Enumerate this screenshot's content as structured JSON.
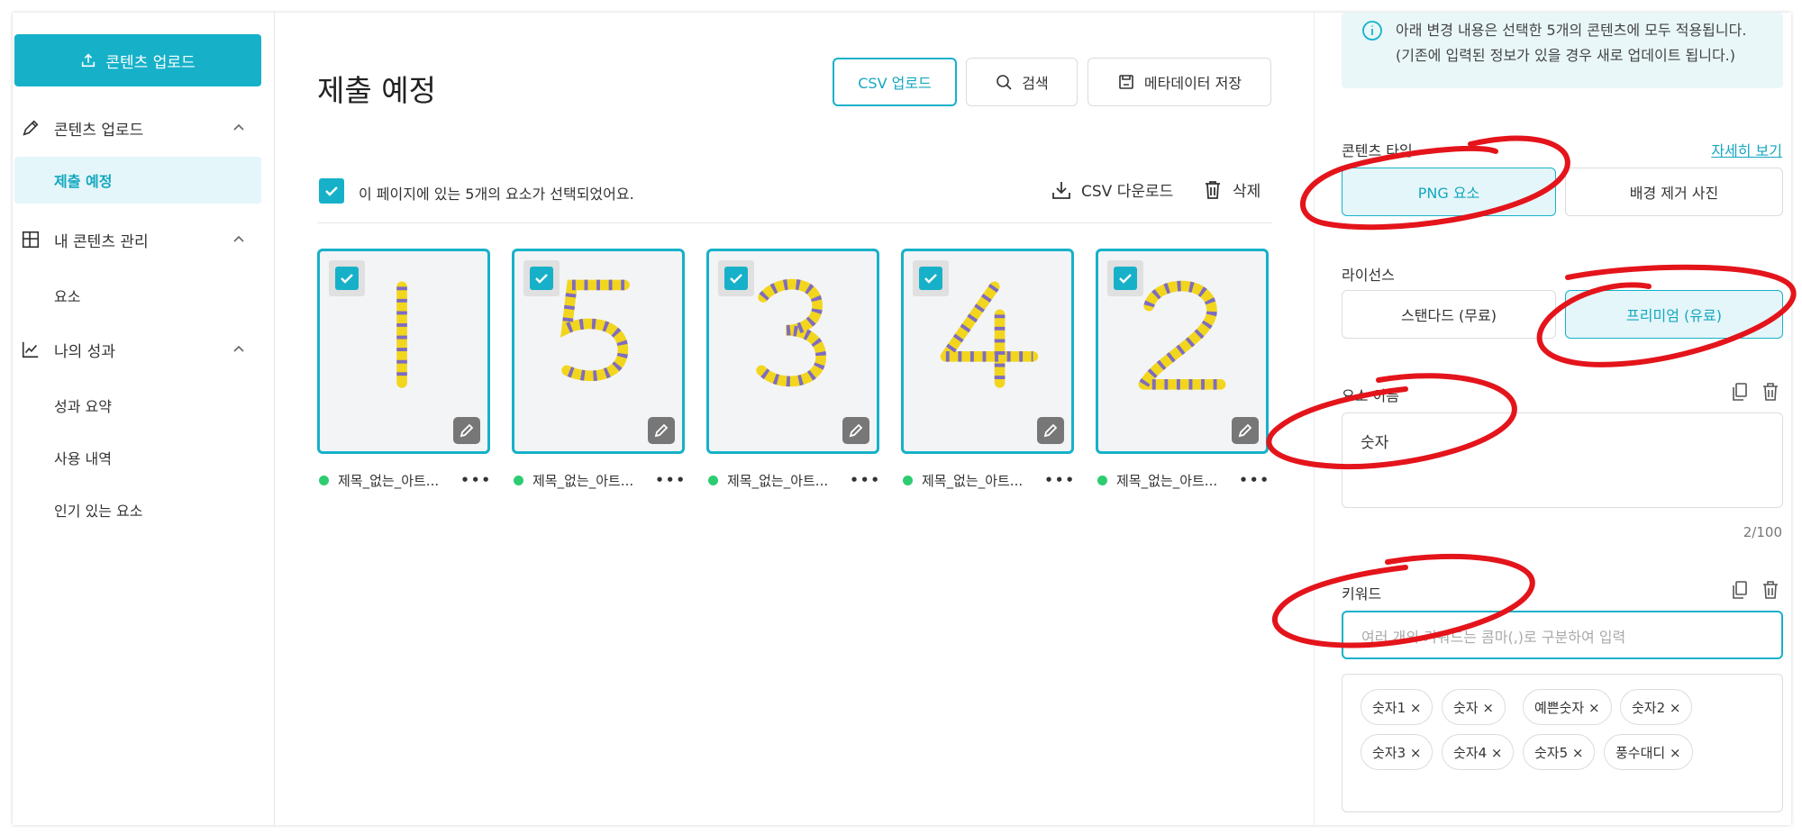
{
  "colors": {
    "accent": "#16b1c9",
    "accent_light": "#e4f6f9",
    "annotation": "#e4141b"
  },
  "sidebar": {
    "upload_button": "콘텐츠 업로드",
    "groups": [
      {
        "label": "콘텐츠 업로드",
        "icon": "pencil-icon"
      },
      {
        "label": "내 콘텐츠 관리",
        "icon": "grid-icon"
      },
      {
        "label": "나의 성과",
        "icon": "chart-line-icon"
      }
    ],
    "items": [
      "제출 예정",
      "요소",
      "성과 요약",
      "사용 내역",
      "인기 있는 요소"
    ]
  },
  "main": {
    "title": "제출 예정",
    "toolbar": {
      "csv_upload": "CSV 업로드",
      "search": "검색",
      "save_metadata": "메타데이터 저장"
    },
    "select_text": "이 페이지에 있는 5개의 요소가 선택되었어요.",
    "csv_download": "CSV 다운로드",
    "delete": "삭제",
    "cards": [
      {
        "digit": "1",
        "caption": "제목_없는_아트..."
      },
      {
        "digit": "5",
        "caption": "제목_없는_아트..."
      },
      {
        "digit": "3",
        "caption": "제목_없는_아트..."
      },
      {
        "digit": "4",
        "caption": "제목_없는_아트..."
      },
      {
        "digit": "2",
        "caption": "제목_없는_아트..."
      }
    ],
    "more": "•••"
  },
  "panel": {
    "notice_line1": "아래 변경 내용은 선택한 5개의 콘텐츠에 모두 적용됩니다.",
    "notice_line2": "(기존에 입력된 정보가 있을 경우 새로 업데이트 됩니다.)",
    "content_type_label": "콘텐츠 타입",
    "details_link": "자세히 보기",
    "content_types": [
      "PNG 요소",
      "배경 제거 사진"
    ],
    "license_label": "라이선스",
    "licenses": [
      "스탠다드 (무료)",
      "프리미엄 (유료)"
    ],
    "name_label": "요소 이름",
    "name_value": "숫자",
    "name_counter": "2/100",
    "keyword_label": "키워드",
    "keyword_placeholder": "여러 개의 키워드는 콤마(,)로 구분하여 입력",
    "keywords": [
      "숫자1 ×",
      "숫자 ×",
      "예쁜숫자 ×",
      "숫자2 ×",
      "숫자3 ×",
      "숫자4 ×",
      "숫자5 ×",
      "풍수대디 ×"
    ]
  }
}
